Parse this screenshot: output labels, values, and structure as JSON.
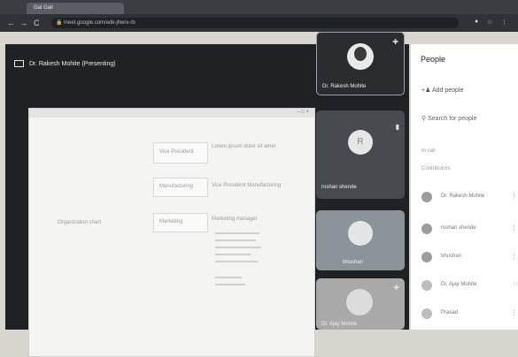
{
  "browser": {
    "tab_title": "Gal Gail",
    "url": "meet.google.com/edk-jhwrx-rb",
    "back": "←",
    "forward": "→",
    "reload": "C"
  },
  "meet": {
    "presenting_label": "Dr. Rakesh Mohite (Presenting)",
    "participants": [
      {
        "name": "Dr. Rakesh Mohite"
      },
      {
        "name": "roshan shende",
        "initial": "R"
      },
      {
        "name": "bhushan"
      },
      {
        "name": "Dr. Ajay Mohite"
      }
    ]
  },
  "shared_screen": {
    "left_caption": "Organization chart",
    "boxes": [
      "Vice President",
      "Manufacturing",
      "Marketing"
    ],
    "right_texts": [
      "Lorem ipsum dolor sit amet",
      "Vice President Manufacturing",
      "Marketing manager"
    ]
  },
  "people_panel": {
    "title": "People",
    "add_people_label": "Add people",
    "search_placeholder": "Search for people",
    "section_in_call": "In call",
    "section_contributors": "Contributors",
    "people": [
      "Dr. Rakesh Mohite",
      "roshan shende",
      "bhushan",
      "Dr. Ajay Mohite",
      "Prasad"
    ]
  },
  "colors": {
    "stage_bg": "#202124",
    "panel_bg": "#ffffff",
    "tab_bar": "#3a3d42"
  }
}
